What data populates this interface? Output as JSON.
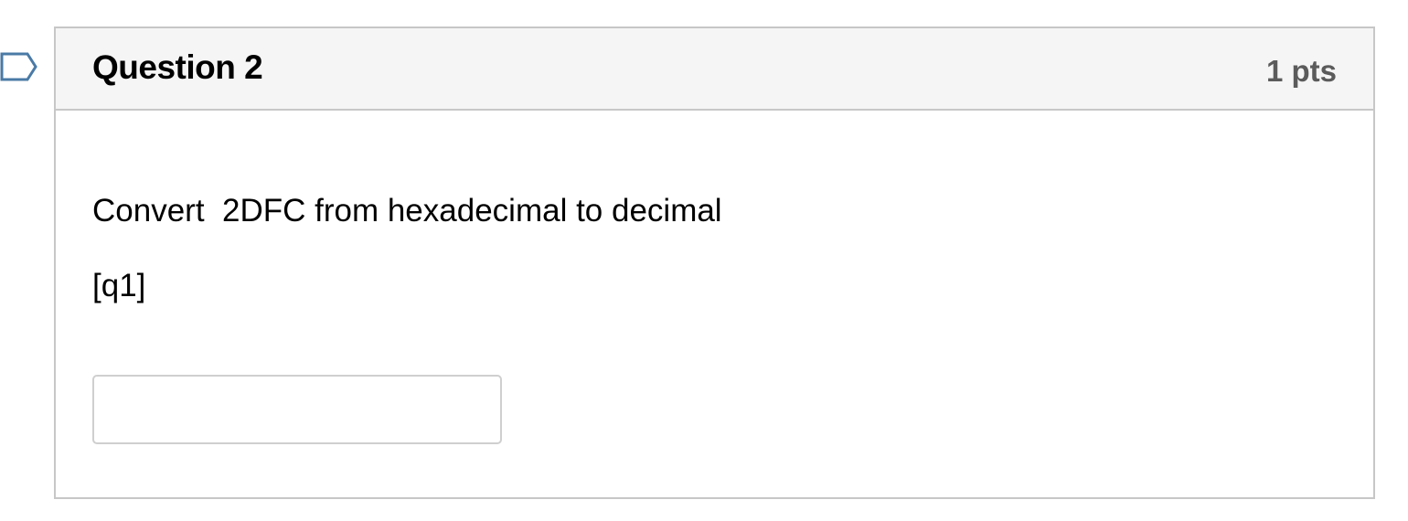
{
  "flag": {
    "icon": "flag-question-icon",
    "stroke_color": "#4a7aa6"
  },
  "question": {
    "title": "Question 2",
    "points": "1 pts",
    "prompt": "Convert  2DFC from hexadecimal to decimal",
    "blank_token": "[q1]",
    "answer": {
      "value": "",
      "placeholder": ""
    }
  },
  "colors": {
    "header_background": "#f5f5f5",
    "border": "#c7c7c7",
    "points_text": "#5b5b5b"
  }
}
